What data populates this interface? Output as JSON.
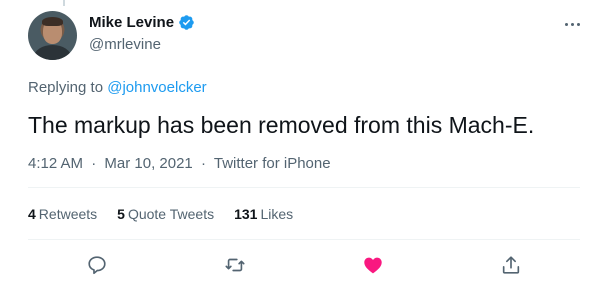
{
  "author": {
    "display_name": "Mike Levine",
    "handle": "@mrlevine",
    "verified": true
  },
  "reply": {
    "prefix": "Replying to",
    "to_handle": "@johnvoelcker"
  },
  "tweet": {
    "text": "The markup has been removed from this Mach-E.",
    "time": "4:12 AM",
    "date": "Mar 10, 2021",
    "source": "Twitter for iPhone",
    "separator": "·"
  },
  "stats": {
    "retweets": {
      "count": "4",
      "label": "Retweets"
    },
    "quote_tweets": {
      "count": "5",
      "label": "Quote Tweets"
    },
    "likes": {
      "count": "131",
      "label": "Likes"
    }
  },
  "actions": {
    "reply_icon": "comment-icon",
    "retweet_icon": "retweet-icon",
    "like_icon": "heart-icon",
    "share_icon": "share-icon"
  },
  "colors": {
    "accent": "#1d9bf0",
    "liked": "#f91880",
    "secondary_text": "#536471",
    "primary_text": "#0f1419"
  }
}
